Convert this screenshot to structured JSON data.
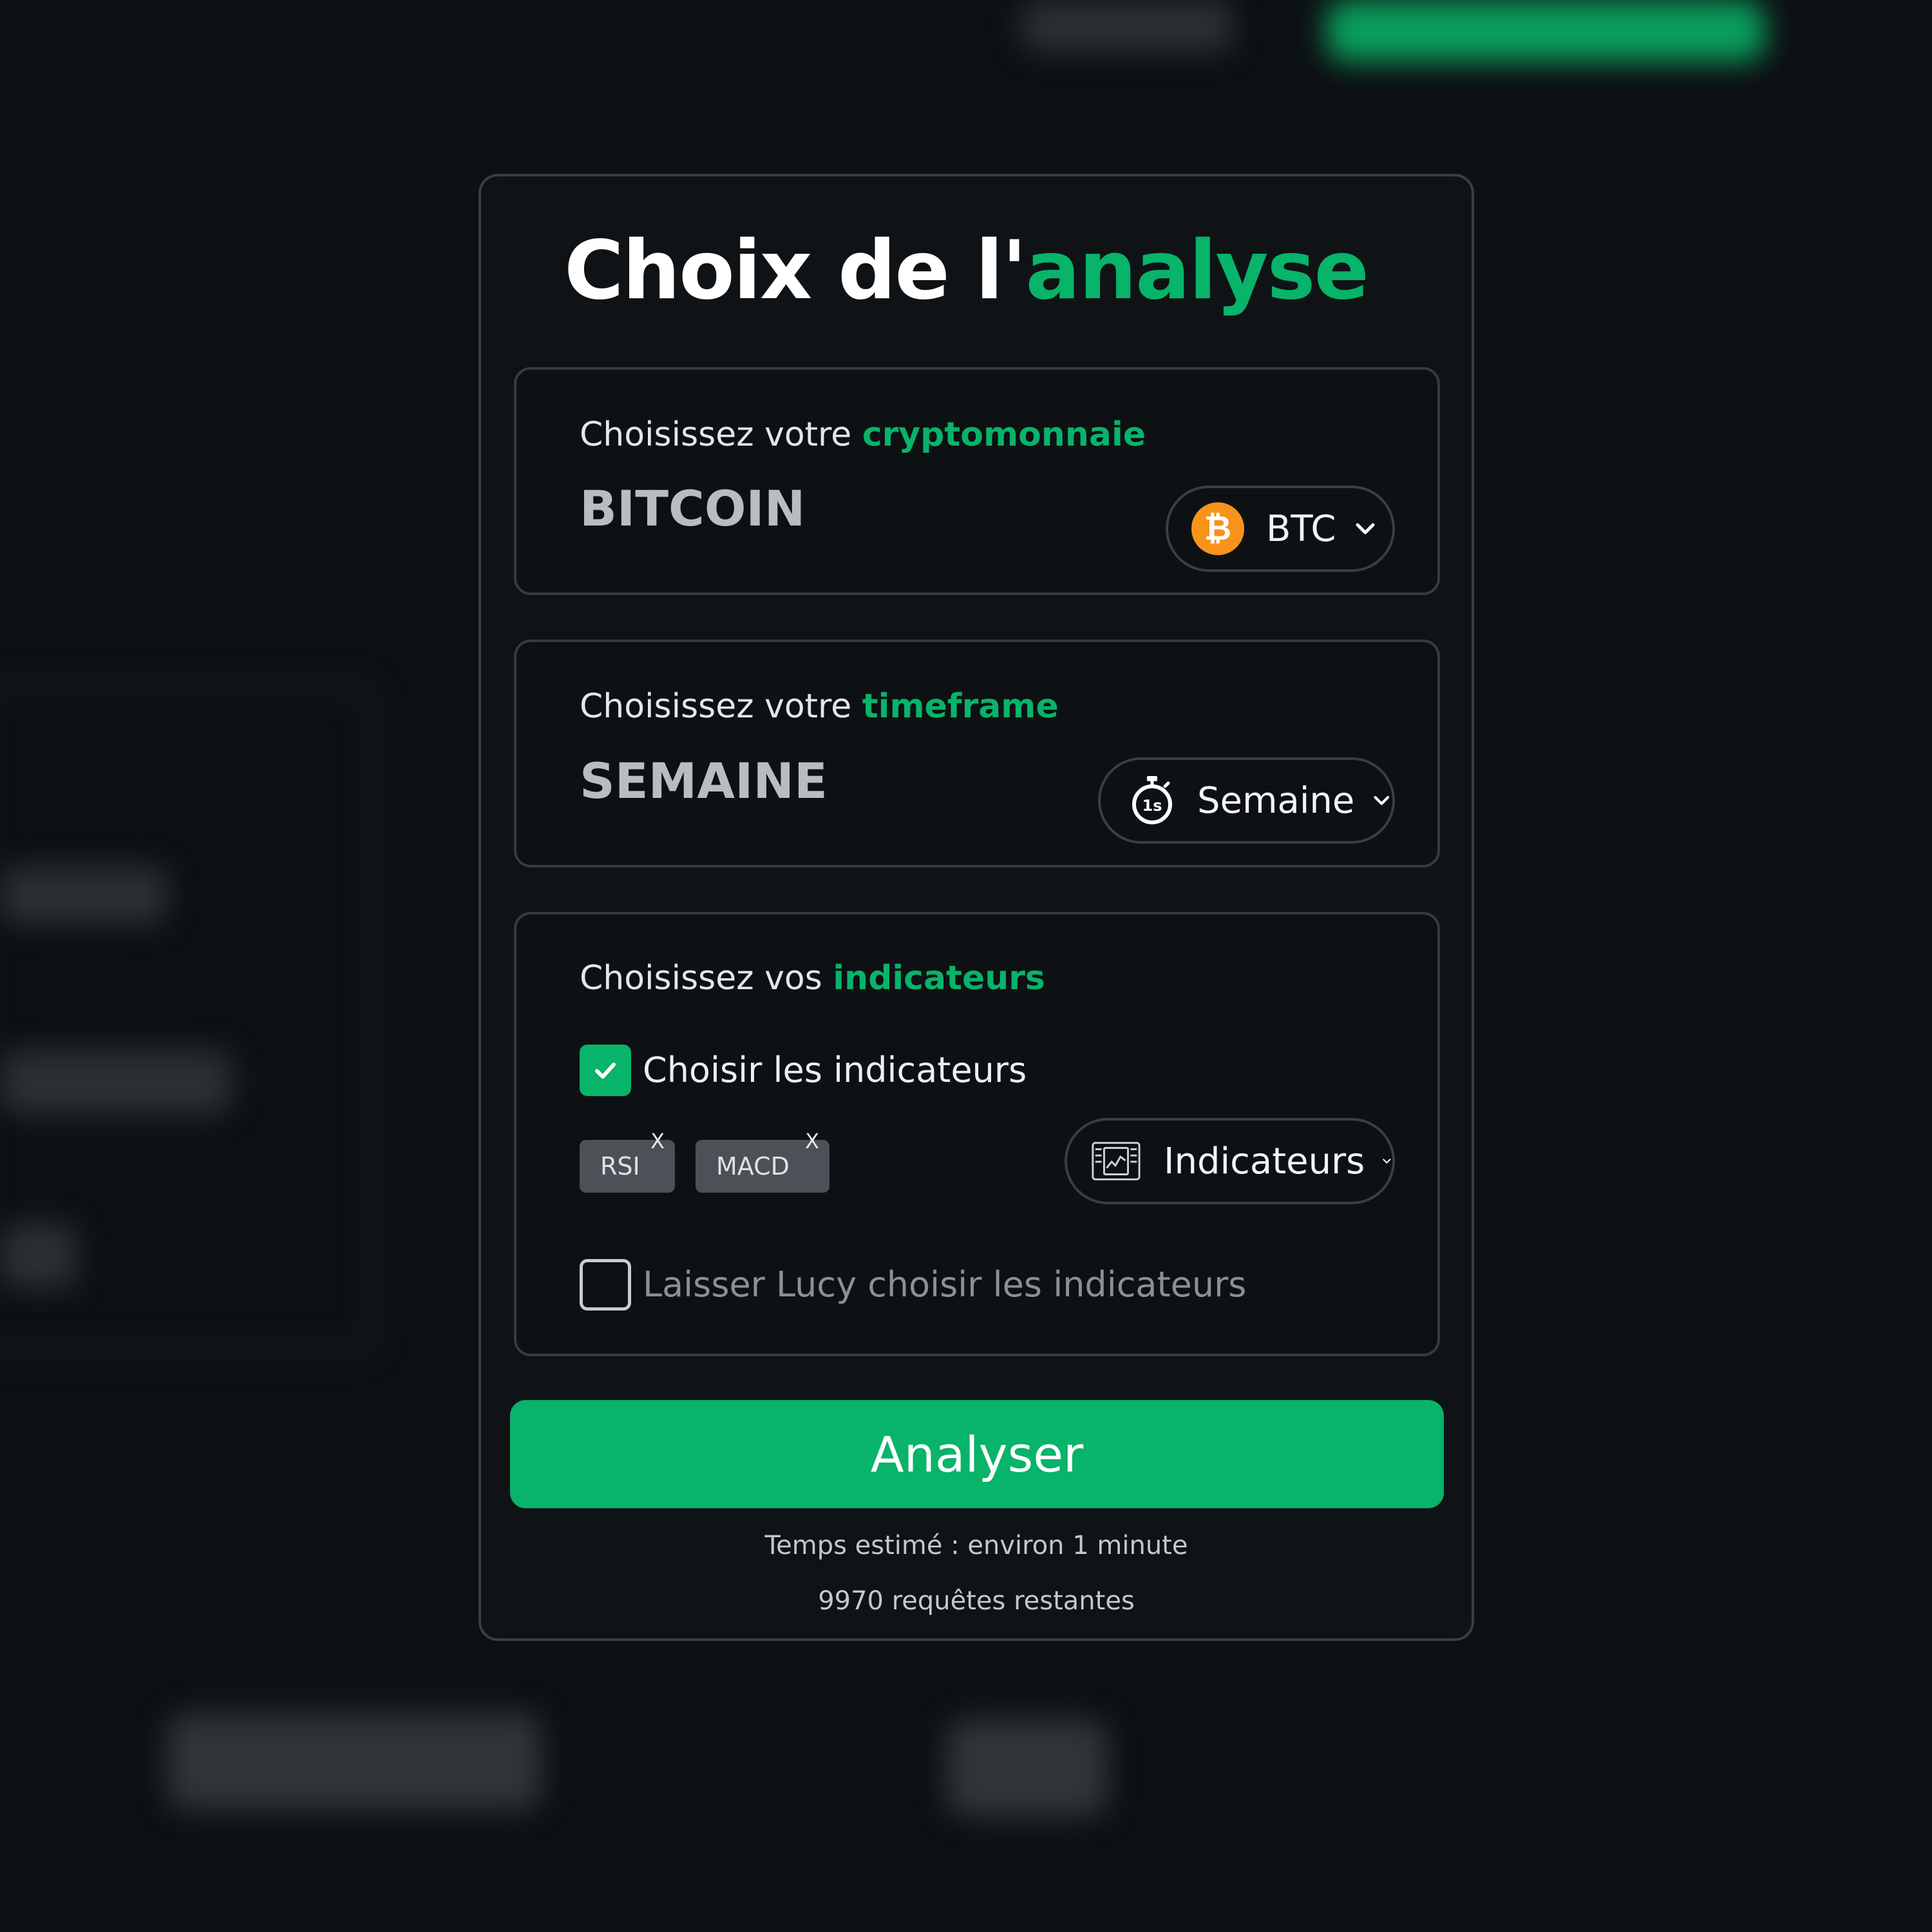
{
  "title": {
    "prefix": "Choix de l'",
    "accent": "analyse"
  },
  "crypto": {
    "label_prefix": "Choisissez votre ",
    "label_accent": "cryptomonnaie",
    "value": "BITCOIN",
    "selected": "BTC",
    "icon": "bitcoin-icon",
    "icon_glyph": "₿"
  },
  "timeframe": {
    "label_prefix": "Choisissez votre ",
    "label_accent": "timeframe",
    "value": "SEMAINE",
    "selected": "Semaine",
    "icon": "stopwatch-icon",
    "icon_text": "1s"
  },
  "indicators": {
    "label_prefix": "Choisissez vos ",
    "label_accent": "indicateurs",
    "choose_checkbox": {
      "label": "Choisir les indicateurs",
      "checked": true
    },
    "chips": [
      {
        "label": "RSI",
        "remove": "X"
      },
      {
        "label": "MACD",
        "remove": "X"
      }
    ],
    "dropdown_label": "Indicateurs",
    "dropdown_icon": "chart-dashboard-icon",
    "lucy_checkbox": {
      "label": "Laisser Lucy choisir les indicateurs",
      "checked": false
    }
  },
  "action": {
    "button_label": "Analyser",
    "estimate": "Temps estimé : environ 1 minute",
    "remaining": "9970 requêtes restantes"
  },
  "colors": {
    "accent": "#08b36a",
    "background": "#0d1114",
    "bitcoin": "#f7931a",
    "chip": "#4b5157"
  }
}
